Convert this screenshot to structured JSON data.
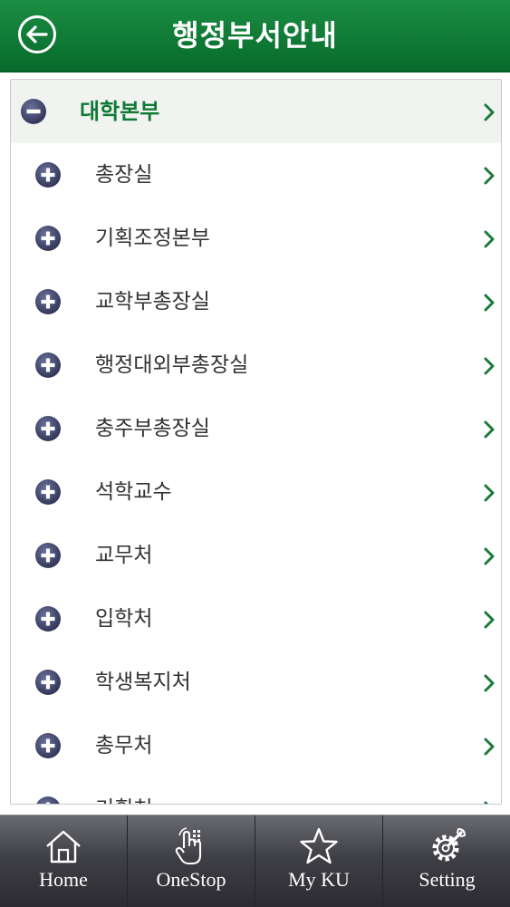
{
  "header": {
    "title": "행정부서안내",
    "back_icon": "back-arrow-icon"
  },
  "colors": {
    "brand_green": "#0f7a35",
    "icon_navy": "#3d4266",
    "tabbar": "#3f3f46"
  },
  "list": {
    "expanded_section": {
      "label": "대학본부",
      "icon": "minus-circle-icon"
    },
    "items": [
      {
        "label": "총장실"
      },
      {
        "label": "기획조정본부"
      },
      {
        "label": "교학부총장실"
      },
      {
        "label": "행정대외부총장실"
      },
      {
        "label": "충주부총장실"
      },
      {
        "label": "석학교수"
      },
      {
        "label": "교무처"
      },
      {
        "label": "입학처"
      },
      {
        "label": "학생복지처"
      },
      {
        "label": "총무처"
      },
      {
        "label": "기획처"
      }
    ]
  },
  "tabbar": {
    "tabs": [
      {
        "label": "Home",
        "icon": "home-icon"
      },
      {
        "label": "OneStop",
        "icon": "touch-icon"
      },
      {
        "label": "My KU",
        "icon": "star-icon"
      },
      {
        "label": "Setting",
        "icon": "settings-icon"
      }
    ]
  }
}
